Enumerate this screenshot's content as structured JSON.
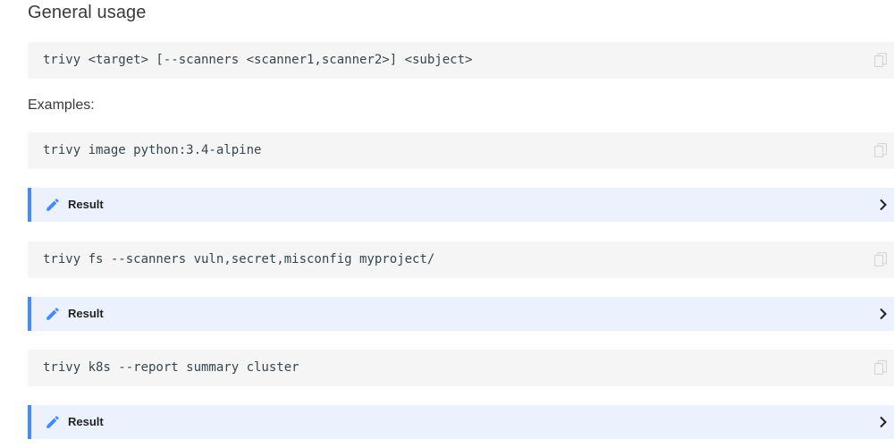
{
  "section": {
    "heading": "General usage",
    "examples_label": "Examples:"
  },
  "usage_code": {
    "command": "trivy <target> [--scanners <scanner1,scanner2>] <subject>"
  },
  "examples": [
    {
      "command": "trivy image python:3.4-alpine",
      "result_label": "Result"
    },
    {
      "command": "trivy fs --scanners vuln,secret,misconfig myproject/",
      "result_label": "Result"
    },
    {
      "command": "trivy k8s --report summary cluster",
      "result_label": "Result"
    }
  ],
  "colors": {
    "accent": "#448aff",
    "admonition_bg": "#ecf2fd",
    "code_bg": "#f5f5f5"
  },
  "icons": {
    "copy": "copy-icon",
    "pencil": "pencil-icon",
    "chevron": "chevron-right-icon"
  }
}
